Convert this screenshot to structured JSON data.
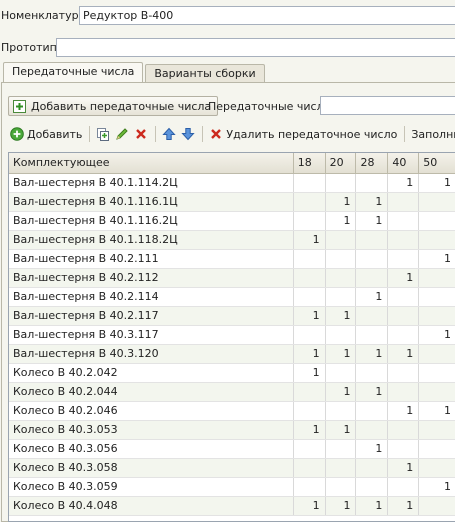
{
  "nomenclature": {
    "label": "Номенклатура:",
    "value": "Редуктор В-400"
  },
  "prototype": {
    "label": "Прототип:",
    "value": ""
  },
  "tabs": [
    {
      "label": "Передаточные числа"
    },
    {
      "label": "Варианты сборки"
    }
  ],
  "ratios_panel": {
    "add_button_label": "Добавить передаточные числа",
    "ratios_label": "Передаточные числа:",
    "ratios_value": ""
  },
  "toolbar": {
    "add_label": "Добавить",
    "delete_ratio_label": "Удалить передаточное число",
    "fill_label": "Заполнить"
  },
  "icons": {
    "add_ratios": "plus-in-box-icon",
    "add": "green-plus-circle-icon",
    "copy": "copy-icon",
    "edit": "pencil-icon",
    "delete": "red-x-icon",
    "move_up": "arrow-up-icon",
    "move_down": "arrow-down-icon",
    "delete_ratio": "red-x-icon"
  },
  "colors": {
    "accent_green": "#3a9a2a",
    "delete_red": "#cc2a1e",
    "arrow_blue": "#3a78c8",
    "row_alt": "#f3f6ee"
  },
  "table": {
    "columns": [
      "Комплектующее",
      "18",
      "20",
      "28",
      "40",
      "50"
    ],
    "rows": [
      {
        "name": "Вал-шестерня В 40.1.114.2Ц",
        "values": [
          "",
          "",
          "",
          "1",
          "1"
        ]
      },
      {
        "name": "Вал-шестерня В 40.1.116.1Ц",
        "values": [
          "",
          "1",
          "1",
          "",
          ""
        ]
      },
      {
        "name": "Вал-шестерня В 40.1.116.2Ц",
        "values": [
          "",
          "1",
          "1",
          "",
          ""
        ]
      },
      {
        "name": "Вал-шестерня В 40.1.118.2Ц",
        "values": [
          "1",
          "",
          "",
          "",
          ""
        ]
      },
      {
        "name": "Вал-шестерня В 40.2.111",
        "values": [
          "",
          "",
          "",
          "",
          "1"
        ]
      },
      {
        "name": "Вал-шестерня В 40.2.112",
        "values": [
          "",
          "",
          "",
          "1",
          ""
        ]
      },
      {
        "name": "Вал-шестерня В 40.2.114",
        "values": [
          "",
          "",
          "1",
          "",
          ""
        ]
      },
      {
        "name": "Вал-шестерня В 40.2.117",
        "values": [
          "1",
          "1",
          "",
          "",
          ""
        ]
      },
      {
        "name": "Вал-шестерня В 40.3.117",
        "values": [
          "",
          "",
          "",
          "",
          "1"
        ]
      },
      {
        "name": "Вал-шестерня В 40.3.120",
        "values": [
          "1",
          "1",
          "1",
          "1",
          ""
        ]
      },
      {
        "name": "Колесо В 40.2.042",
        "values": [
          "1",
          "",
          "",
          "",
          ""
        ]
      },
      {
        "name": "Колесо В 40.2.044",
        "values": [
          "",
          "1",
          "1",
          "",
          ""
        ]
      },
      {
        "name": "Колесо В 40.2.046",
        "values": [
          "",
          "",
          "",
          "1",
          "1"
        ]
      },
      {
        "name": "Колесо В 40.3.053",
        "values": [
          "1",
          "1",
          "",
          "",
          ""
        ]
      },
      {
        "name": "Колесо В 40.3.056",
        "values": [
          "",
          "",
          "1",
          "",
          ""
        ]
      },
      {
        "name": "Колесо В 40.3.058",
        "values": [
          "",
          "",
          "",
          "1",
          ""
        ]
      },
      {
        "name": "Колесо В 40.3.059",
        "values": [
          "",
          "",
          "",
          "",
          "1"
        ]
      },
      {
        "name": "Колесо В 40.4.048",
        "values": [
          "1",
          "1",
          "1",
          "1",
          ""
        ]
      }
    ]
  }
}
